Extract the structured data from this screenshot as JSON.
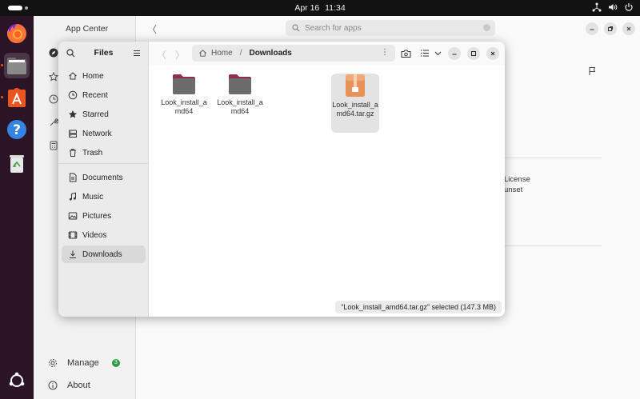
{
  "topbar": {
    "date": "Apr 16",
    "time": "11:34"
  },
  "dock": {
    "items": [
      {
        "name": "firefox-icon"
      },
      {
        "name": "files-icon"
      },
      {
        "name": "app-center-icon"
      },
      {
        "name": "help-icon"
      },
      {
        "name": "trash-icon"
      }
    ]
  },
  "appcenter": {
    "title": "App Center",
    "search": {
      "placeholder": "Search for apps"
    },
    "bottom": {
      "manage_label": "Manage",
      "manage_badge": "3",
      "about_label": "About"
    },
    "license_label": "License",
    "license_value": "unset"
  },
  "files": {
    "title": "Files",
    "sidebar": {
      "group1": [
        {
          "label": "Home",
          "icon": "home-icon"
        },
        {
          "label": "Recent",
          "icon": "clock-icon"
        },
        {
          "label": "Starred",
          "icon": "star-icon"
        },
        {
          "label": "Network",
          "icon": "network-icon"
        },
        {
          "label": "Trash",
          "icon": "trash-icon"
        }
      ],
      "group2": [
        {
          "label": "Documents",
          "icon": "document-icon"
        },
        {
          "label": "Music",
          "icon": "music-icon"
        },
        {
          "label": "Pictures",
          "icon": "picture-icon"
        },
        {
          "label": "Videos",
          "icon": "video-icon"
        },
        {
          "label": "Downloads",
          "icon": "download-icon"
        }
      ]
    },
    "path": {
      "home": "Home",
      "current": "Downloads"
    },
    "items": [
      {
        "name": "Look_install_amd64",
        "type": "folder"
      },
      {
        "name": "Look_install_amd64",
        "type": "folder"
      },
      {
        "name": "Look_install_amd64.tar.gz",
        "type": "archive"
      }
    ],
    "status": "“Look_install_amd64.tar.gz” selected  (147.3 MB)"
  }
}
